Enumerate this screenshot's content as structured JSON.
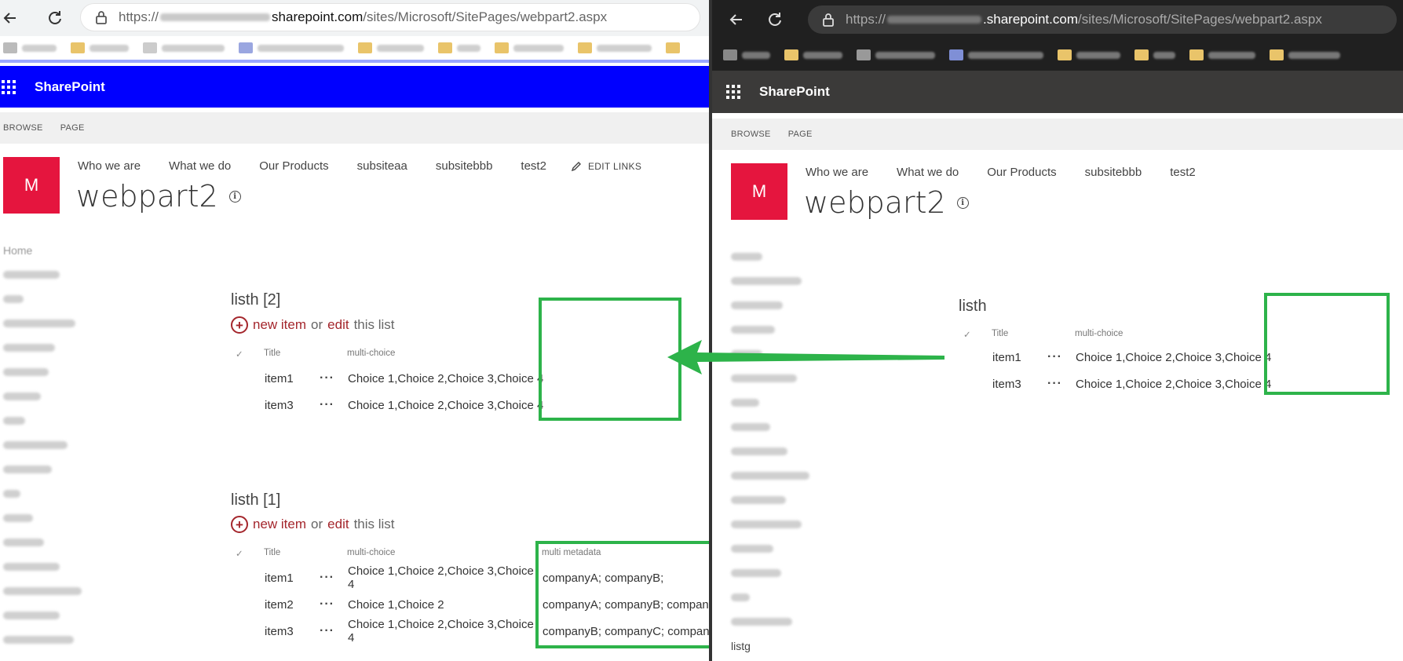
{
  "left": {
    "url": {
      "prefix": "https://",
      "host": "sharepoint.com",
      "path": "/sites/Microsoft/SitePages/webpart2.aspx"
    },
    "suite": {
      "brand": "SharePoint",
      "color": "#0000ff"
    },
    "ribbon": {
      "browse": "BROWSE",
      "page": "PAGE"
    },
    "logo_letter": "M",
    "topnav": [
      "Who we are",
      "What we do",
      "Our Products",
      "subsiteaa",
      "subsitebbb",
      "test2"
    ],
    "edit_links": "EDIT LINKS",
    "page_title": "webpart2",
    "quicklaunch_first": "Home",
    "webpart1": {
      "title": "listh [2]",
      "new_item": "new item",
      "or": "or",
      "edit": "edit",
      "this_list": "this list",
      "headers": {
        "title": "Title",
        "multi": "multi-choice"
      },
      "rows": [
        {
          "title": "item1",
          "choices": "Choice 1,Choice 2,Choice 3,Choice 4"
        },
        {
          "title": "item3",
          "choices": "Choice 1,Choice 2,Choice 3,Choice 4"
        }
      ]
    },
    "webpart2": {
      "title": "listh [1]",
      "new_item": "new item",
      "or": "or",
      "edit": "edit",
      "this_list": "this list",
      "headers": {
        "title": "Title",
        "multi": "multi-choice",
        "meta": "multi metadata"
      },
      "rows": [
        {
          "title": "item1",
          "choices": "Choice 1,Choice 2,Choice 3,Choice 4",
          "meta": "companyA; companyB;"
        },
        {
          "title": "item2",
          "choices": "Choice 1,Choice 2",
          "meta": "companyA; companyB; companyC"
        },
        {
          "title": "item3",
          "choices": "Choice 1,Choice 2,Choice 3,Choice 4",
          "meta": "companyB; companyC; companyD"
        }
      ]
    }
  },
  "right": {
    "url": {
      "prefix": "https://",
      "host": ".sharepoint.com",
      "path": "/sites/Microsoft/SitePages/webpart2.aspx"
    },
    "suite": {
      "brand": "SharePoint",
      "color": "#3b3a39"
    },
    "ribbon": {
      "browse": "BROWSE",
      "page": "PAGE"
    },
    "logo_letter": "M",
    "topnav": [
      "Who we are",
      "What we do",
      "Our Products",
      "subsitebbb",
      "test2"
    ],
    "page_title": "webpart2",
    "quicklaunch_last": "listg",
    "webpart": {
      "title": "listh",
      "headers": {
        "title": "Title",
        "multi": "multi-choice"
      },
      "rows": [
        {
          "title": "item1",
          "choices": "Choice 1,Choice 2,Choice 3,Choice 4"
        },
        {
          "title": "item3",
          "choices": "Choice 1,Choice 2,Choice 3,Choice 4"
        }
      ]
    }
  },
  "highlight_color": "#2db34a",
  "icons": [
    "back-icon",
    "refresh-icon",
    "lock-icon",
    "waffle-icon",
    "pencil-icon",
    "info-icon",
    "plus-circle-icon",
    "checkmark-icon",
    "ellipsis-icon",
    "arrow-icon"
  ]
}
